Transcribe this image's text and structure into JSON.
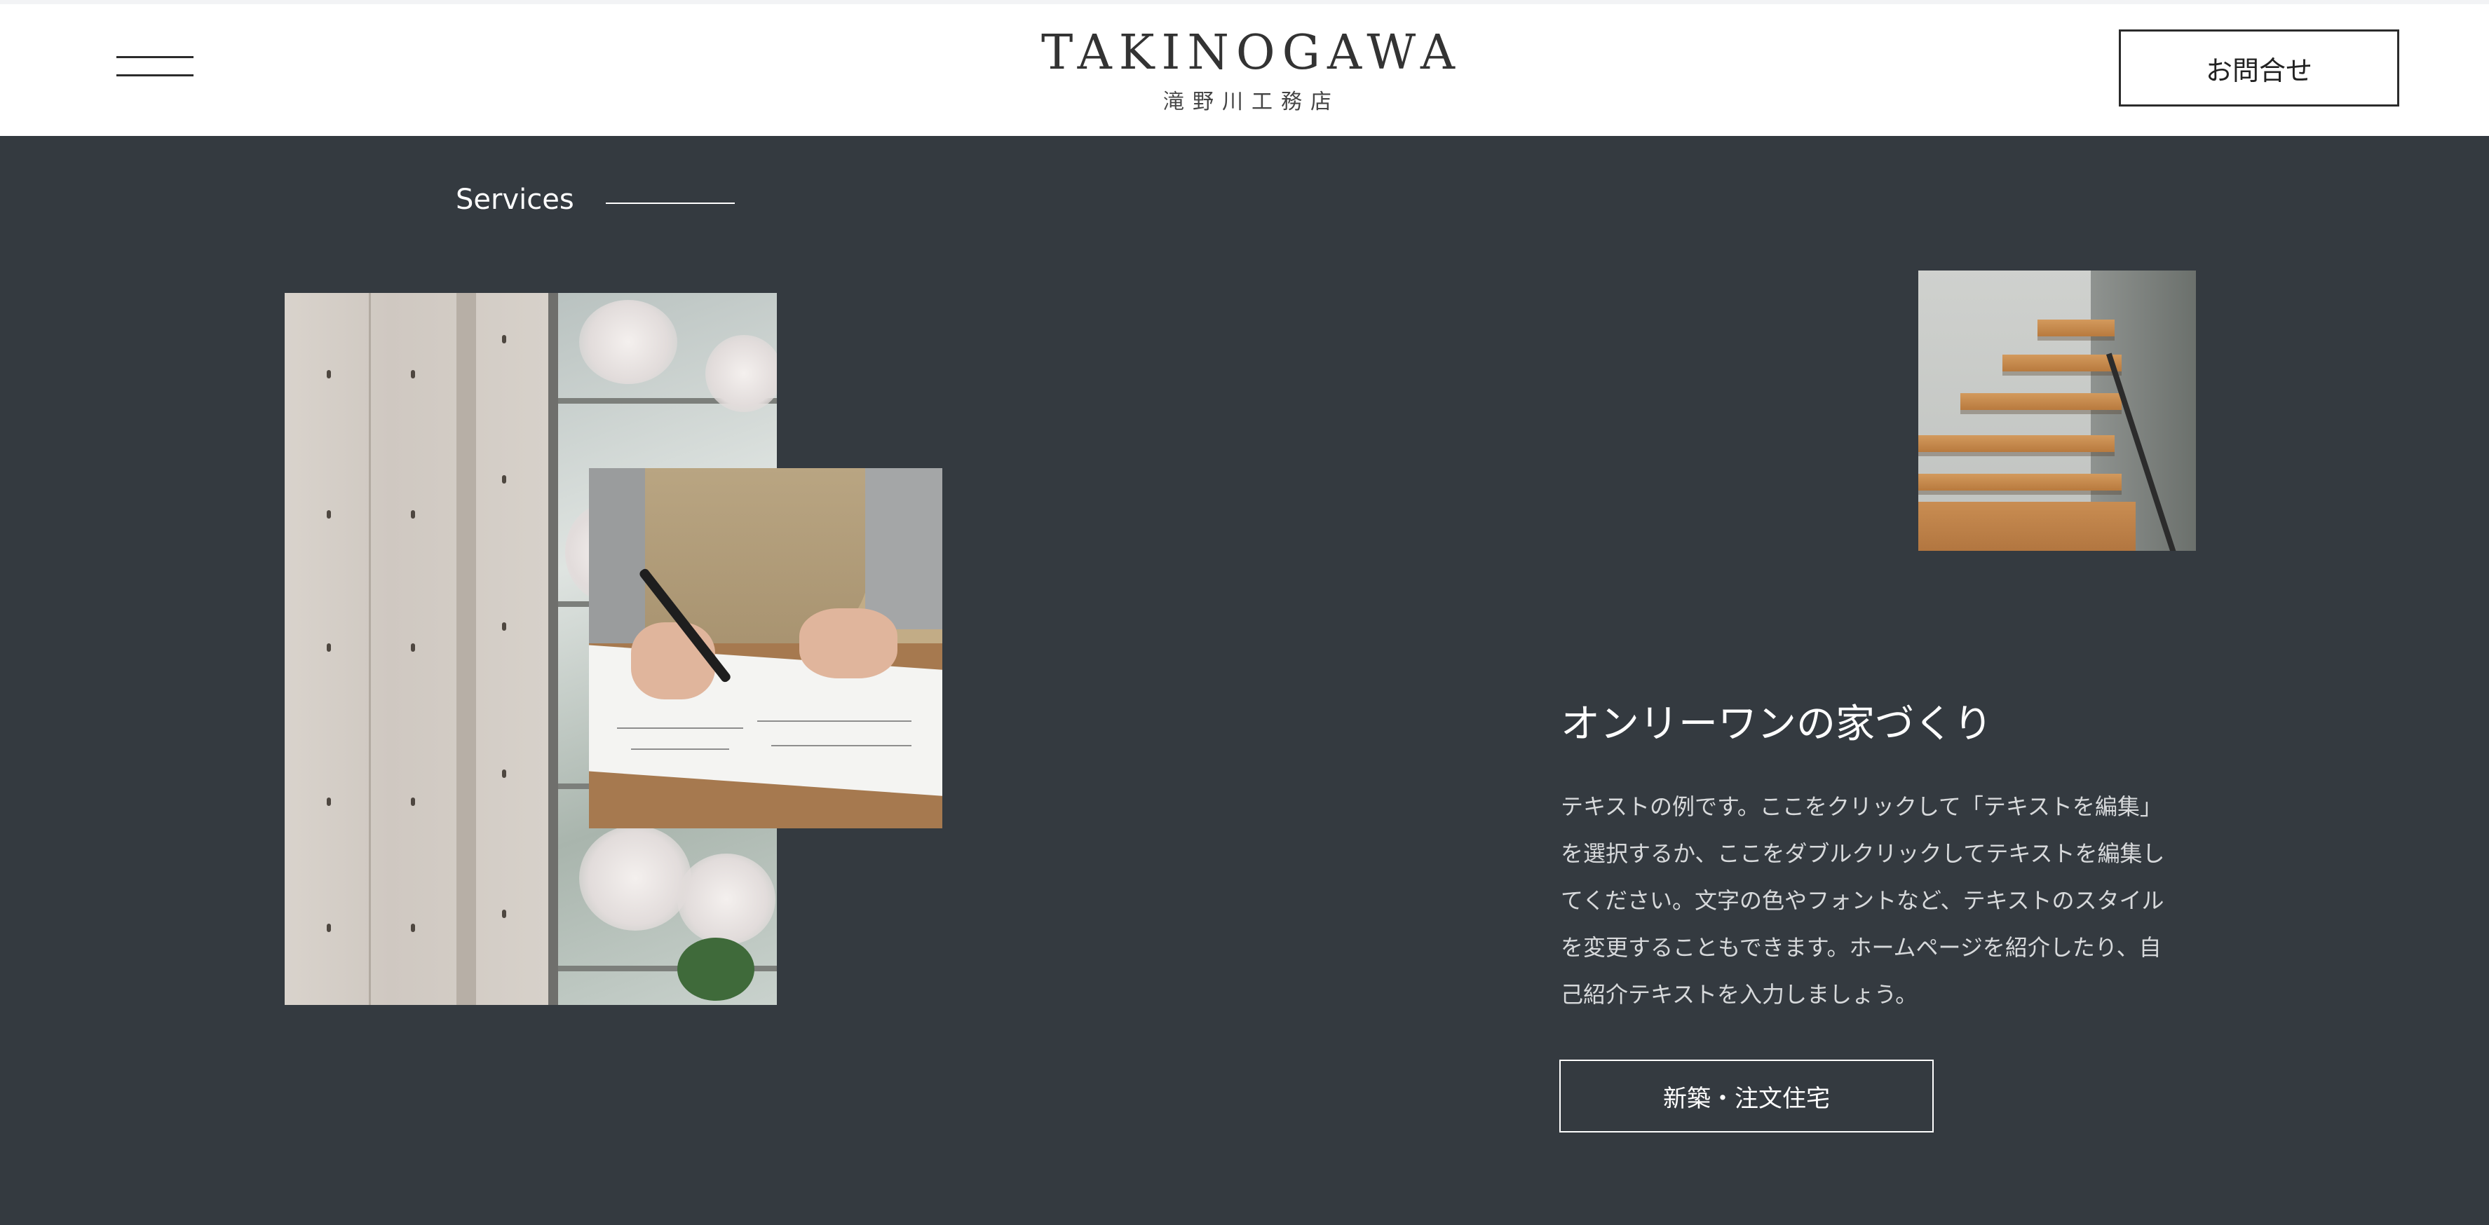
{
  "header": {
    "brand_name": "TAKINOGAWA",
    "brand_sub": "滝野川工務店",
    "contact_label": "お問合せ",
    "menu_icon": "hamburger-icon"
  },
  "section": {
    "label": "Services"
  },
  "feature": {
    "heading": "オンリーワンの家づくり",
    "body_lines": [
      "テキストの例です。ここをクリックして「テキストを編集」",
      "を選択するか、ここをダブルクリックしてテキストを編集し",
      "てください。文字の色やフォントなど、テキストのスタイル",
      "を変更することもできます。ホームページを紹介したり、自",
      "己紹介テキストを入力しましょう。"
    ],
    "cta_label": "新築・注文住宅"
  },
  "colors": {
    "header_bg": "#ffffff",
    "section_bg": "#343a40",
    "text_light": "#ffffff"
  }
}
